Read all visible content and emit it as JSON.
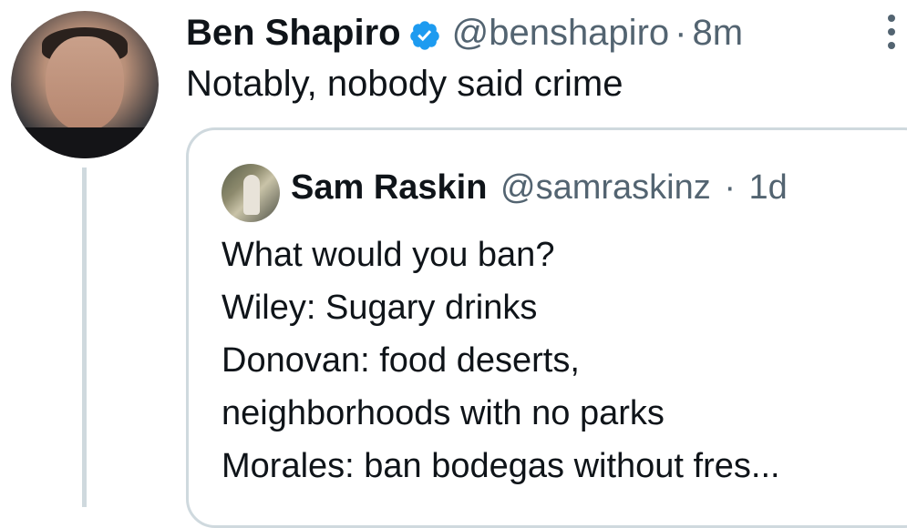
{
  "tweet": {
    "author_name": "Ben Shapiro",
    "handle": "@benshapiro",
    "separator": "·",
    "time": "8m",
    "text": "Notably, nobody said crime",
    "verified_icon": "verified-badge-icon",
    "more_icon": "more-options-icon"
  },
  "quoted_tweet": {
    "author_name": "Sam Raskin",
    "handle": "@samraskinz",
    "separator": "·",
    "time": "1d",
    "lines": [
      "What would you ban?",
      "Wiley: Sugary drinks",
      "Donovan: food deserts,",
      "neighborhoods with no parks",
      "Morales: ban bodegas without fres..."
    ]
  },
  "colors": {
    "text": "#0f1419",
    "secondary": "#536471",
    "verified": "#1d9bf0",
    "border": "#cfd9de"
  }
}
